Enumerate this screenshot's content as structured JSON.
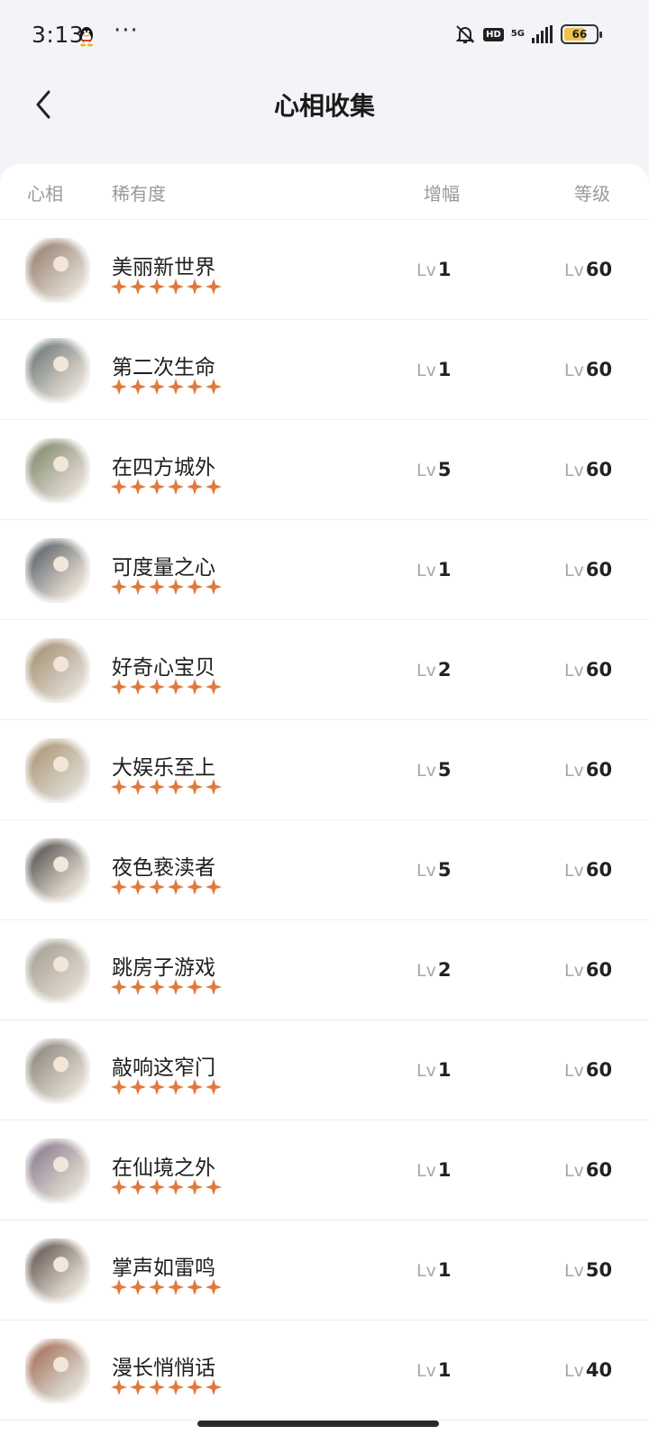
{
  "status": {
    "time": "3:13",
    "dots": "···",
    "hd": "HD",
    "network": "5G",
    "battery": "66"
  },
  "header": {
    "title": "心相收集"
  },
  "columns": {
    "col1": "心相",
    "col2": "稀有度",
    "col3": "增幅",
    "col4": "等级"
  },
  "lv_prefix": "Lv",
  "star_color": "#e07a3c",
  "rows": [
    {
      "name": "美丽新世界",
      "boost": "1",
      "level": "60",
      "thumb": "#8b6f5d"
    },
    {
      "name": "第二次生命",
      "boost": "1",
      "level": "60",
      "thumb": "#56646a"
    },
    {
      "name": "在四方城外",
      "boost": "5",
      "level": "60",
      "thumb": "#6f7b5a"
    },
    {
      "name": "可度量之心",
      "boost": "1",
      "level": "60",
      "thumb": "#3e4755"
    },
    {
      "name": "好奇心宝贝",
      "boost": "2",
      "level": "60",
      "thumb": "#9a8460"
    },
    {
      "name": "大娱乐至上",
      "boost": "5",
      "level": "60",
      "thumb": "#a48a64"
    },
    {
      "name": "夜色亵渎者",
      "boost": "5",
      "level": "60",
      "thumb": "#3a3634"
    },
    {
      "name": "跳房子游戏",
      "boost": "2",
      "level": "60",
      "thumb": "#9b9488"
    },
    {
      "name": "敲响这窄门",
      "boost": "1",
      "level": "60",
      "thumb": "#7c756c"
    },
    {
      "name": "在仙境之外",
      "boost": "1",
      "level": "60",
      "thumb": "#7b6a86"
    },
    {
      "name": "掌声如雷鸣",
      "boost": "1",
      "level": "50",
      "thumb": "#4b3c35"
    },
    {
      "name": "漫长悄悄话",
      "boost": "1",
      "level": "40",
      "thumb": "#9a5a3e"
    }
  ]
}
